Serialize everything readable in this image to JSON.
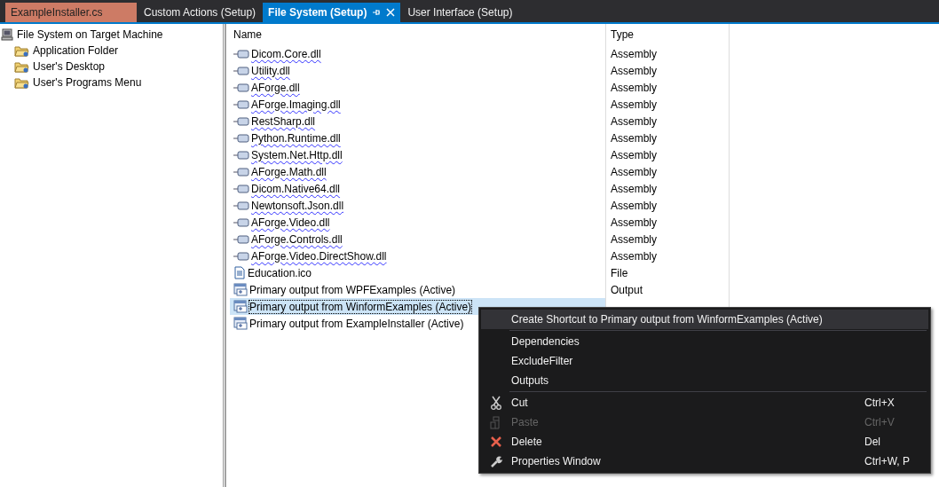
{
  "tabs": [
    {
      "label": "ExampleInstaller.cs",
      "kind": "modified",
      "selected": false
    },
    {
      "label": "Custom Actions (Setup)",
      "kind": "normal",
      "selected": false
    },
    {
      "label": "File System (Setup)",
      "kind": "normal",
      "selected": true
    },
    {
      "label": "User Interface (Setup)",
      "kind": "normal",
      "selected": false
    }
  ],
  "tree": {
    "label": "File System on Target Machine",
    "children": [
      {
        "label": "Application Folder"
      },
      {
        "label": "User's Desktop"
      },
      {
        "label": "User's Programs Menu"
      }
    ]
  },
  "list": {
    "columns": [
      "Name",
      "Type"
    ],
    "rows": [
      {
        "name": "Dicom.Core.dll",
        "type": "Assembly",
        "kind": "assembly",
        "warning": true,
        "selected": false
      },
      {
        "name": "Utility.dll",
        "type": "Assembly",
        "kind": "assembly",
        "warning": true,
        "selected": false
      },
      {
        "name": "AForge.dll",
        "type": "Assembly",
        "kind": "assembly",
        "warning": true,
        "selected": false
      },
      {
        "name": "AForge.Imaging.dll",
        "type": "Assembly",
        "kind": "assembly",
        "warning": true,
        "selected": false
      },
      {
        "name": "RestSharp.dll",
        "type": "Assembly",
        "kind": "assembly",
        "warning": true,
        "selected": false
      },
      {
        "name": "Python.Runtime.dll",
        "type": "Assembly",
        "kind": "assembly",
        "warning": true,
        "selected": false
      },
      {
        "name": "System.Net.Http.dll",
        "type": "Assembly",
        "kind": "assembly",
        "warning": true,
        "selected": false
      },
      {
        "name": "AForge.Math.dll",
        "type": "Assembly",
        "kind": "assembly",
        "warning": true,
        "selected": false
      },
      {
        "name": "Dicom.Native64.dll",
        "type": "Assembly",
        "kind": "assembly",
        "warning": true,
        "selected": false
      },
      {
        "name": "Newtonsoft.Json.dll",
        "type": "Assembly",
        "kind": "assembly",
        "warning": true,
        "selected": false
      },
      {
        "name": "AForge.Video.dll",
        "type": "Assembly",
        "kind": "assembly",
        "warning": true,
        "selected": false
      },
      {
        "name": "AForge.Controls.dll",
        "type": "Assembly",
        "kind": "assembly",
        "warning": true,
        "selected": false
      },
      {
        "name": "AForge.Video.DirectShow.dll",
        "type": "Assembly",
        "kind": "assembly",
        "warning": true,
        "selected": false
      },
      {
        "name": "Education.ico",
        "type": "File",
        "kind": "file",
        "warning": false,
        "selected": false
      },
      {
        "name": "Primary output from WPFExamples (Active)",
        "type": "Output",
        "kind": "output",
        "warning": false,
        "selected": false
      },
      {
        "name": "Primary output from WinformExamples (Active)",
        "kind": "output",
        "warning": false,
        "selected": true
      },
      {
        "name": "Primary output from ExampleInstaller (Active)",
        "kind": "output",
        "warning": false,
        "selected": false
      }
    ]
  },
  "context_menu": {
    "items": [
      {
        "kind": "item",
        "label": "Create Shortcut to Primary output from WinformExamples (Active)",
        "disabled": false,
        "selected": true
      },
      {
        "kind": "separator"
      },
      {
        "kind": "item",
        "label": "Dependencies",
        "disabled": false,
        "selected": false
      },
      {
        "kind": "item",
        "label": "ExcludeFilter",
        "disabled": false,
        "selected": false
      },
      {
        "kind": "item",
        "label": "Outputs",
        "disabled": false,
        "selected": false
      },
      {
        "kind": "separator"
      },
      {
        "kind": "cut",
        "label": "Cut",
        "shortcut": "Ctrl+X",
        "disabled": false,
        "selected": false
      },
      {
        "kind": "paste",
        "label": "Paste",
        "shortcut": "Ctrl+V",
        "disabled": true,
        "selected": false
      },
      {
        "kind": "delete",
        "label": "Delete",
        "shortcut": "Del",
        "disabled": false,
        "selected": false
      },
      {
        "kind": "properties",
        "label": "Properties Window",
        "shortcut": "Ctrl+W, P",
        "disabled": false,
        "selected": false
      }
    ]
  }
}
